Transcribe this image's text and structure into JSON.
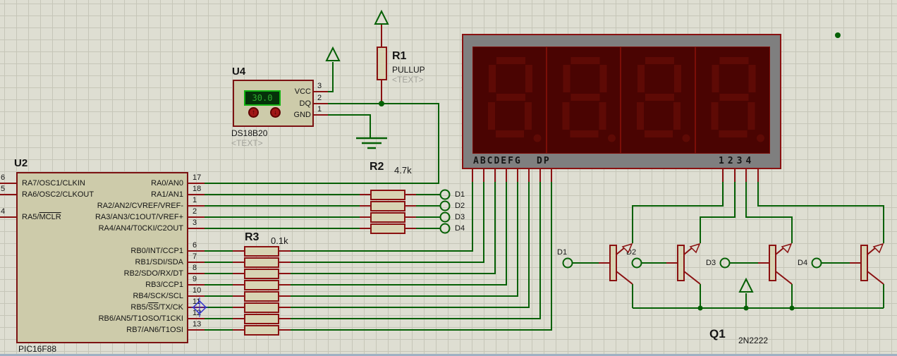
{
  "colors": {
    "wire": "#056005",
    "pin": "#8a1111",
    "body_fill": "#d8d4b4",
    "display_body": "#7f7f7f",
    "display_bg": "#4a0402",
    "segment": "#5e0a05",
    "lcd_border": "#12b212",
    "lcd_bg": "#05320a",
    "lcd_text": "#2fae2f"
  },
  "u2": {
    "ref": "U2",
    "value": "PIC16F88",
    "left_pins": [
      {
        "num": "6",
        "pre": "RA7/OSC1/CLKIN",
        "ov": ""
      },
      {
        "num": "5",
        "pre": "RA6/OSC2/CLKOUT",
        "ov": ""
      },
      {
        "num": "4",
        "pre": "RA5/",
        "ov": "MCLR"
      }
    ],
    "right_pins": [
      {
        "num": "17",
        "pre": "RA0/AN0",
        "ov": "",
        "post": ""
      },
      {
        "num": "18",
        "pre": "RA1/AN1",
        "ov": "",
        "post": ""
      },
      {
        "num": "1",
        "pre": "RA2/AN2/CVREF/VREF-",
        "ov": "",
        "post": ""
      },
      {
        "num": "2",
        "pre": "RA3/AN3/C1OUT/VREF+",
        "ov": "",
        "post": ""
      },
      {
        "num": "3",
        "pre": "RA4/AN4/T0CKI/C2OUT",
        "ov": "",
        "post": ""
      },
      {
        "num": "6",
        "pre": "RB0/INT/CCP1",
        "ov": "",
        "post": ""
      },
      {
        "num": "7",
        "pre": "RB1/SDI/SDA",
        "ov": "",
        "post": ""
      },
      {
        "num": "8",
        "pre": "RB2/SDO/RX/DT",
        "ov": "",
        "post": ""
      },
      {
        "num": "9",
        "pre": "RB3/CCP1",
        "ov": "",
        "post": ""
      },
      {
        "num": "10",
        "pre": "RB4/SCK/SCL",
        "ov": "",
        "post": ""
      },
      {
        "num": "11",
        "pre": "RB5/",
        "ov": "SS",
        "post": "/TX/CK"
      },
      {
        "num": "12",
        "pre": "RB6/AN5/T1OSO/T1CKI",
        "ov": "",
        "post": ""
      },
      {
        "num": "13",
        "pre": "RB7/AN6/T1OSI",
        "ov": "",
        "post": ""
      }
    ]
  },
  "u4": {
    "ref": "U4",
    "value": "DS18B20",
    "placeholder": "<TEXT>",
    "reading": "30.0",
    "up_icon": "↑",
    "down_icon": "↓",
    "pins": [
      {
        "num": "3",
        "name": "VCC"
      },
      {
        "num": "2",
        "name": "DQ"
      },
      {
        "num": "1",
        "name": "GND"
      }
    ]
  },
  "r1": {
    "ref": "R1",
    "value": "PULLUP",
    "placeholder": "<TEXT>"
  },
  "r2": {
    "ref": "R2",
    "value": "4.7k"
  },
  "r3": {
    "ref": "R3",
    "value": "0.1k"
  },
  "q1": {
    "ref": "Q1",
    "value": "2N2222"
  },
  "display7seg": {
    "segment_labels": "ABCDEFG",
    "dp_label": "DP",
    "digit_labels": "1234"
  },
  "terminals": {
    "left": [
      "D1",
      "D2",
      "D3",
      "D4"
    ],
    "base": [
      "D1",
      "D2",
      "D3",
      "D4"
    ]
  }
}
